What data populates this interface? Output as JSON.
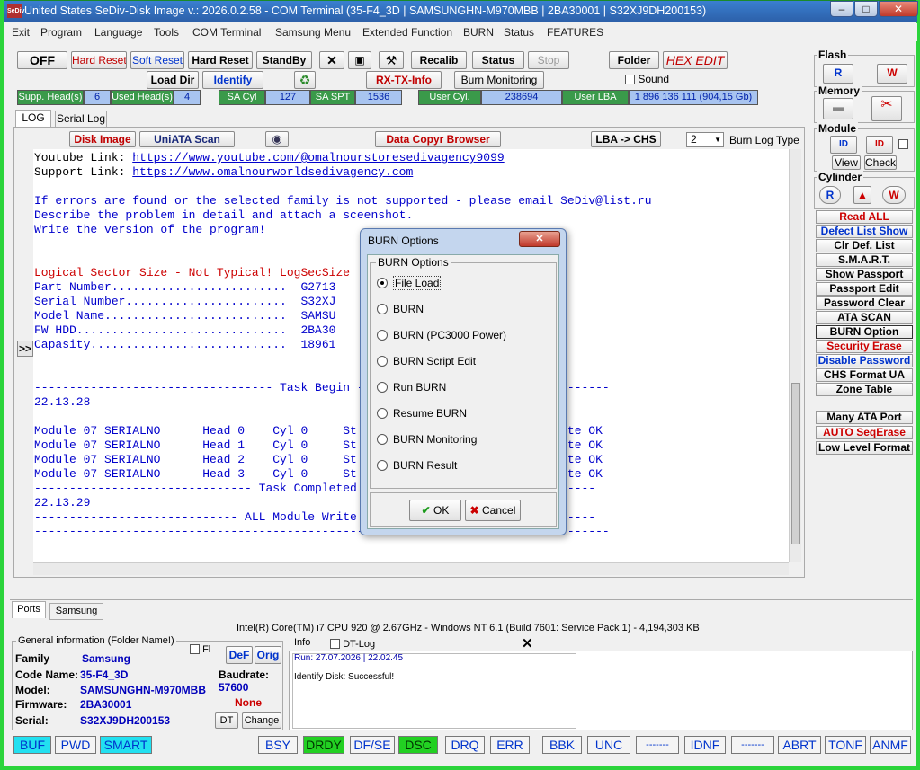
{
  "window": {
    "title": "United States  SeDiv-Disk Image v.: 2026.0.2.58 - COM Terminal  (35-F4_3D | SAMSUNGHN-M970MBB | 2BA30001 | S32XJ9DH200153)",
    "logo": "SeDiv",
    "min": "–",
    "max": "□",
    "close": "✕"
  },
  "menu": [
    "Exit",
    "Program",
    "Language",
    "Tools",
    "COM Terminal",
    "Samsung Menu",
    "Extended Function",
    "BURN",
    "Status",
    "FEATURES"
  ],
  "toolbar": {
    "off": "OFF",
    "hard_reset": "Hard Reset",
    "soft_reset": "Soft Reset",
    "hard_reset2": "Hard Reset",
    "standby": "StandBy",
    "x": "✕",
    "save": "💾",
    "tools": "⚒",
    "recalib": "Recalib",
    "status": "Status",
    "stop": "Stop",
    "folder": "Folder",
    "hex_edit": "HEX EDIT",
    "load_dir": "Load Dir",
    "identify": "Identify",
    "refresh": "♻",
    "rx_tx": "RX-TX-Info",
    "burn_monitoring": "Burn Monitoring",
    "sound": "Sound"
  },
  "stats": {
    "supp_heads_lbl": "Supp. Head(s)",
    "supp_heads": "6",
    "used_heads_lbl": "Used Head(s)",
    "used_heads": "4",
    "sa_cyl_lbl": "SA Cyl",
    "sa_cyl": "127",
    "sa_spt_lbl": "SA SPT",
    "sa_spt": "1536",
    "user_cyl_lbl": "User Cyl.",
    "user_cyl": "238694",
    "user_lba_lbl": "User LBA",
    "user_lba": "1 896 136 111  (904,15 Gb)"
  },
  "tabs": {
    "log": "LOG",
    "serial_log": "Serial Log"
  },
  "subtoolbar": {
    "disk_image": "Disk Image",
    "uniata": "UniATA Scan",
    "data_copyr": "Data Copyr Browser",
    "lba_chs": "LBA -> CHS",
    "burn_log_val": "2",
    "burn_log_type": "Burn Log Type",
    "collapse": ">>"
  },
  "log": {
    "yt_label": "Youtube Link: ",
    "yt_link": "https://www.youtube.com/@omalnourstoresedivagency9099",
    "sp_label": "Support Link: ",
    "sp_link": "https://www.omalnourworldsedivagency.com",
    "err1": "If errors are found or the selected family is not supported - please email SeDiv@list.ru",
    "err2": "Describe the problem in detail and attach a sceenshot.",
    "err3": "Write the version of the program!",
    "logsec": "Logical Sector Size - Not Typical! LogSecSize",
    "part": "Part Number.........................  G2713",
    "serial": "Serial Number.......................  S32XJ",
    "model": "Model Name..........................  SAMSU",
    "fw": "FW HDD..............................  2BA30",
    "cap": "Capasity............................  18961",
    "task_begin": "---------------------------------- Task Begin ------------------------------------",
    "t1": "22.13.28",
    "m0": "Module 07 SERIALNO      Head 0    Cyl 0     St                           Write OK",
    "m1": "Module 07 SERIALNO      Head 1    Cyl 0     St                           Write OK",
    "m2": "Module 07 SERIALNO      Head 2    Cyl 0     St                           Write OK",
    "m3": "Module 07 SERIALNO      Head 3    Cyl 0     St                           Write OK",
    "task_done": "------------------------------- Task Completed ---------------------------------",
    "t2": "22.13.29",
    "all_mod": "----------------------------- ALL Module Write ---------------------------------",
    "dash": "----------------------------------------------------------------------------------"
  },
  "right": {
    "flash": "Flash",
    "memory": "Memory",
    "module": "Module",
    "view": "View",
    "check": "Check",
    "cylinder": "Cylinder",
    "read_all": "Read ALL",
    "defect_list_show": "Defect List Show",
    "clr_def": "Clr Def. List",
    "smart": "S.M.A.R.T.",
    "show_passport": "Show Passport",
    "passport_edit": "Passport Edit",
    "password_clear": "Password Clear",
    "ata_scan": "ATA SCAN",
    "burn_option": "BURN Option",
    "security_erase": "Security Erase",
    "disable_password": "Disable Password",
    "chs_format": "CHS Format UA",
    "zone_table": "Zone Table",
    "many_ata": "Many ATA Port",
    "auto_seq": "AUTO SeqErase",
    "low_level": "Low Level Format",
    "r": "R",
    "w": "W",
    "id": "ID"
  },
  "bottom_tabs": {
    "ports": "Ports",
    "samsung": "Samsung"
  },
  "cpu": "Intel(R) Core(TM) i7 CPU 920  @ 2.67GHz - Windows NT 6.1 (Build 7601: Service Pack 1) -  4,194,303 KB",
  "general": {
    "title": "General information (Folder Name!)",
    "fl": "Fl",
    "def": "DeF",
    "orig": "Orig",
    "family_lbl": "Family",
    "family": "Samsung",
    "code_lbl": "Code Name:",
    "code": "35-F4_3D",
    "model_lbl": "Model:",
    "model": "SAMSUNGHN-M970MBB",
    "fw_lbl": "Firmware:",
    "fw": "2BA30001",
    "serial_lbl": "Serial:",
    "serial": "S32XJ9DH200153",
    "baud_lbl": "Baudrate:",
    "baud": "57600",
    "none": "None",
    "dt": "DT",
    "change": "Change"
  },
  "info": {
    "title": "Info",
    "dt_log": "DT-Log",
    "close": "✕",
    "run": "Run: 27.07.2026 | 22.02.45",
    "msg": "Identify Disk: Successful!"
  },
  "status_bar": [
    "BUF",
    "PWD",
    "SMART",
    "BSY",
    "DRDY",
    "DF/SE",
    "DSC",
    "DRQ",
    "ERR",
    "BBK",
    "UNC",
    "-------",
    "IDNF",
    "-------",
    "ABRT",
    "TONF",
    "ANMF"
  ],
  "dialog": {
    "title": "BURN Options",
    "group": "BURN Options",
    "close": "✕",
    "options": [
      "File Load",
      "BURN",
      "BURN (PC3000 Power)",
      "BURN Script Edit",
      "Run BURN",
      "Resume BURN",
      "BURN Monitoring",
      "BURN Result"
    ],
    "ok": "OK",
    "cancel": "Cancel"
  },
  "colors": {
    "accent_green": "#2bd43b",
    "title_blue": "#2c5fa8",
    "status_cyan": "#22e0f0",
    "status_green": "#22d022"
  }
}
